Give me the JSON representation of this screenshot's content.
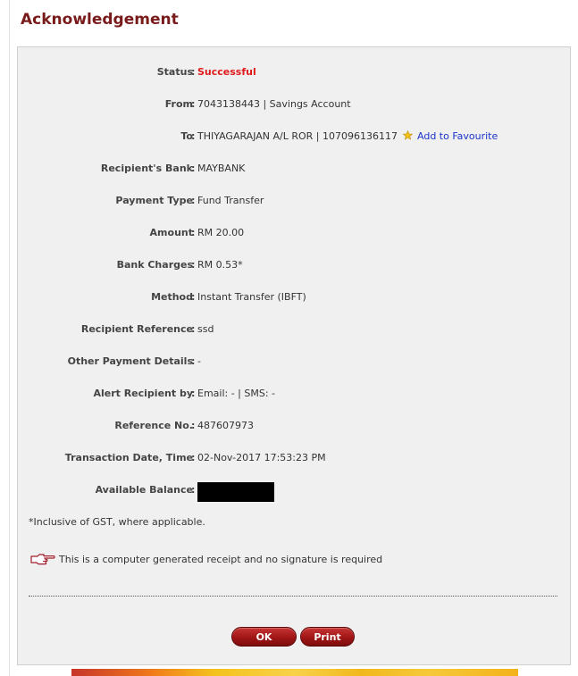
{
  "page": {
    "title": "Acknowledgement"
  },
  "details": {
    "status": {
      "label": "Status",
      "value": "Successful"
    },
    "from": {
      "label": "From",
      "value": "7043138443 | Savings Account"
    },
    "to": {
      "label": "To",
      "value": "THIYAGARAJAN A/L ROR | 107096136117",
      "link": "Add to Favourite",
      "icon": "star-icon"
    },
    "recipient_bank": {
      "label": "Recipient's Bank",
      "value": "MAYBANK"
    },
    "payment_type": {
      "label": "Payment Type",
      "value": "Fund Transfer"
    },
    "amount": {
      "label": "Amount",
      "value": "RM 20.00"
    },
    "bank_charges": {
      "label": "Bank Charges",
      "value": "RM 0.53*"
    },
    "method": {
      "label": "Method",
      "value": "Instant Transfer (IBFT)"
    },
    "recipient_reference": {
      "label": "Recipient Reference",
      "value": "ssd"
    },
    "other_payment_details": {
      "label": "Other Payment Details",
      "value": "-"
    },
    "alert_recipient": {
      "label": "Alert Recipient by",
      "value": "Email: - | SMS: -"
    },
    "reference_no": {
      "label": "Reference No.",
      "value": "487607973"
    },
    "transaction_datetime": {
      "label": "Transaction Date, Time",
      "value": "02-Nov-2017 17:53:23 PM"
    },
    "available_balance": {
      "label": "Available Balance",
      "value_redacted": true
    }
  },
  "notes": {
    "gst": "*Inclusive of GST, where applicable.",
    "receipt": "This is a computer generated receipt and no signature is required",
    "receipt_icon": "pointing-hand-icon"
  },
  "buttons": {
    "ok": "OK",
    "print": "Print"
  },
  "colors": {
    "title": "#7a1b1b",
    "success": "#e01a1a",
    "link": "#1a33cc",
    "button": "#a01616",
    "panel_bg": "#f0f0f0"
  }
}
